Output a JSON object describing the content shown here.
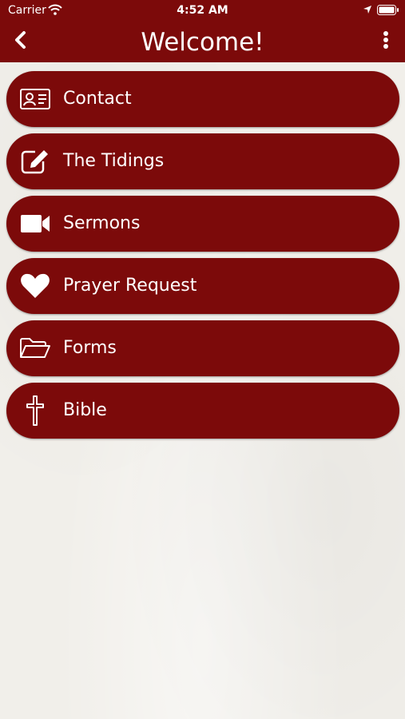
{
  "status_bar": {
    "carrier": "Carrier",
    "time": "4:52 AM",
    "icons": [
      "wifi-icon",
      "location-icon",
      "battery-icon"
    ]
  },
  "nav": {
    "title": "Welcome!",
    "back_icon": "chevron-left-icon",
    "more_icon": "vertical-dots-icon"
  },
  "menu": {
    "items": [
      {
        "label": "Contact",
        "icon": "contact-card-icon"
      },
      {
        "label": "The Tidings",
        "icon": "edit-pencil-icon"
      },
      {
        "label": "Sermons",
        "icon": "video-camera-icon"
      },
      {
        "label": "Prayer Request",
        "icon": "heart-icon"
      },
      {
        "label": "Forms",
        "icon": "folder-open-icon"
      },
      {
        "label": "Bible",
        "icon": "cross-icon"
      }
    ]
  },
  "colors": {
    "brand": "#7c0a0a",
    "background": "#f1efea",
    "text_on_brand": "#ffffff"
  }
}
